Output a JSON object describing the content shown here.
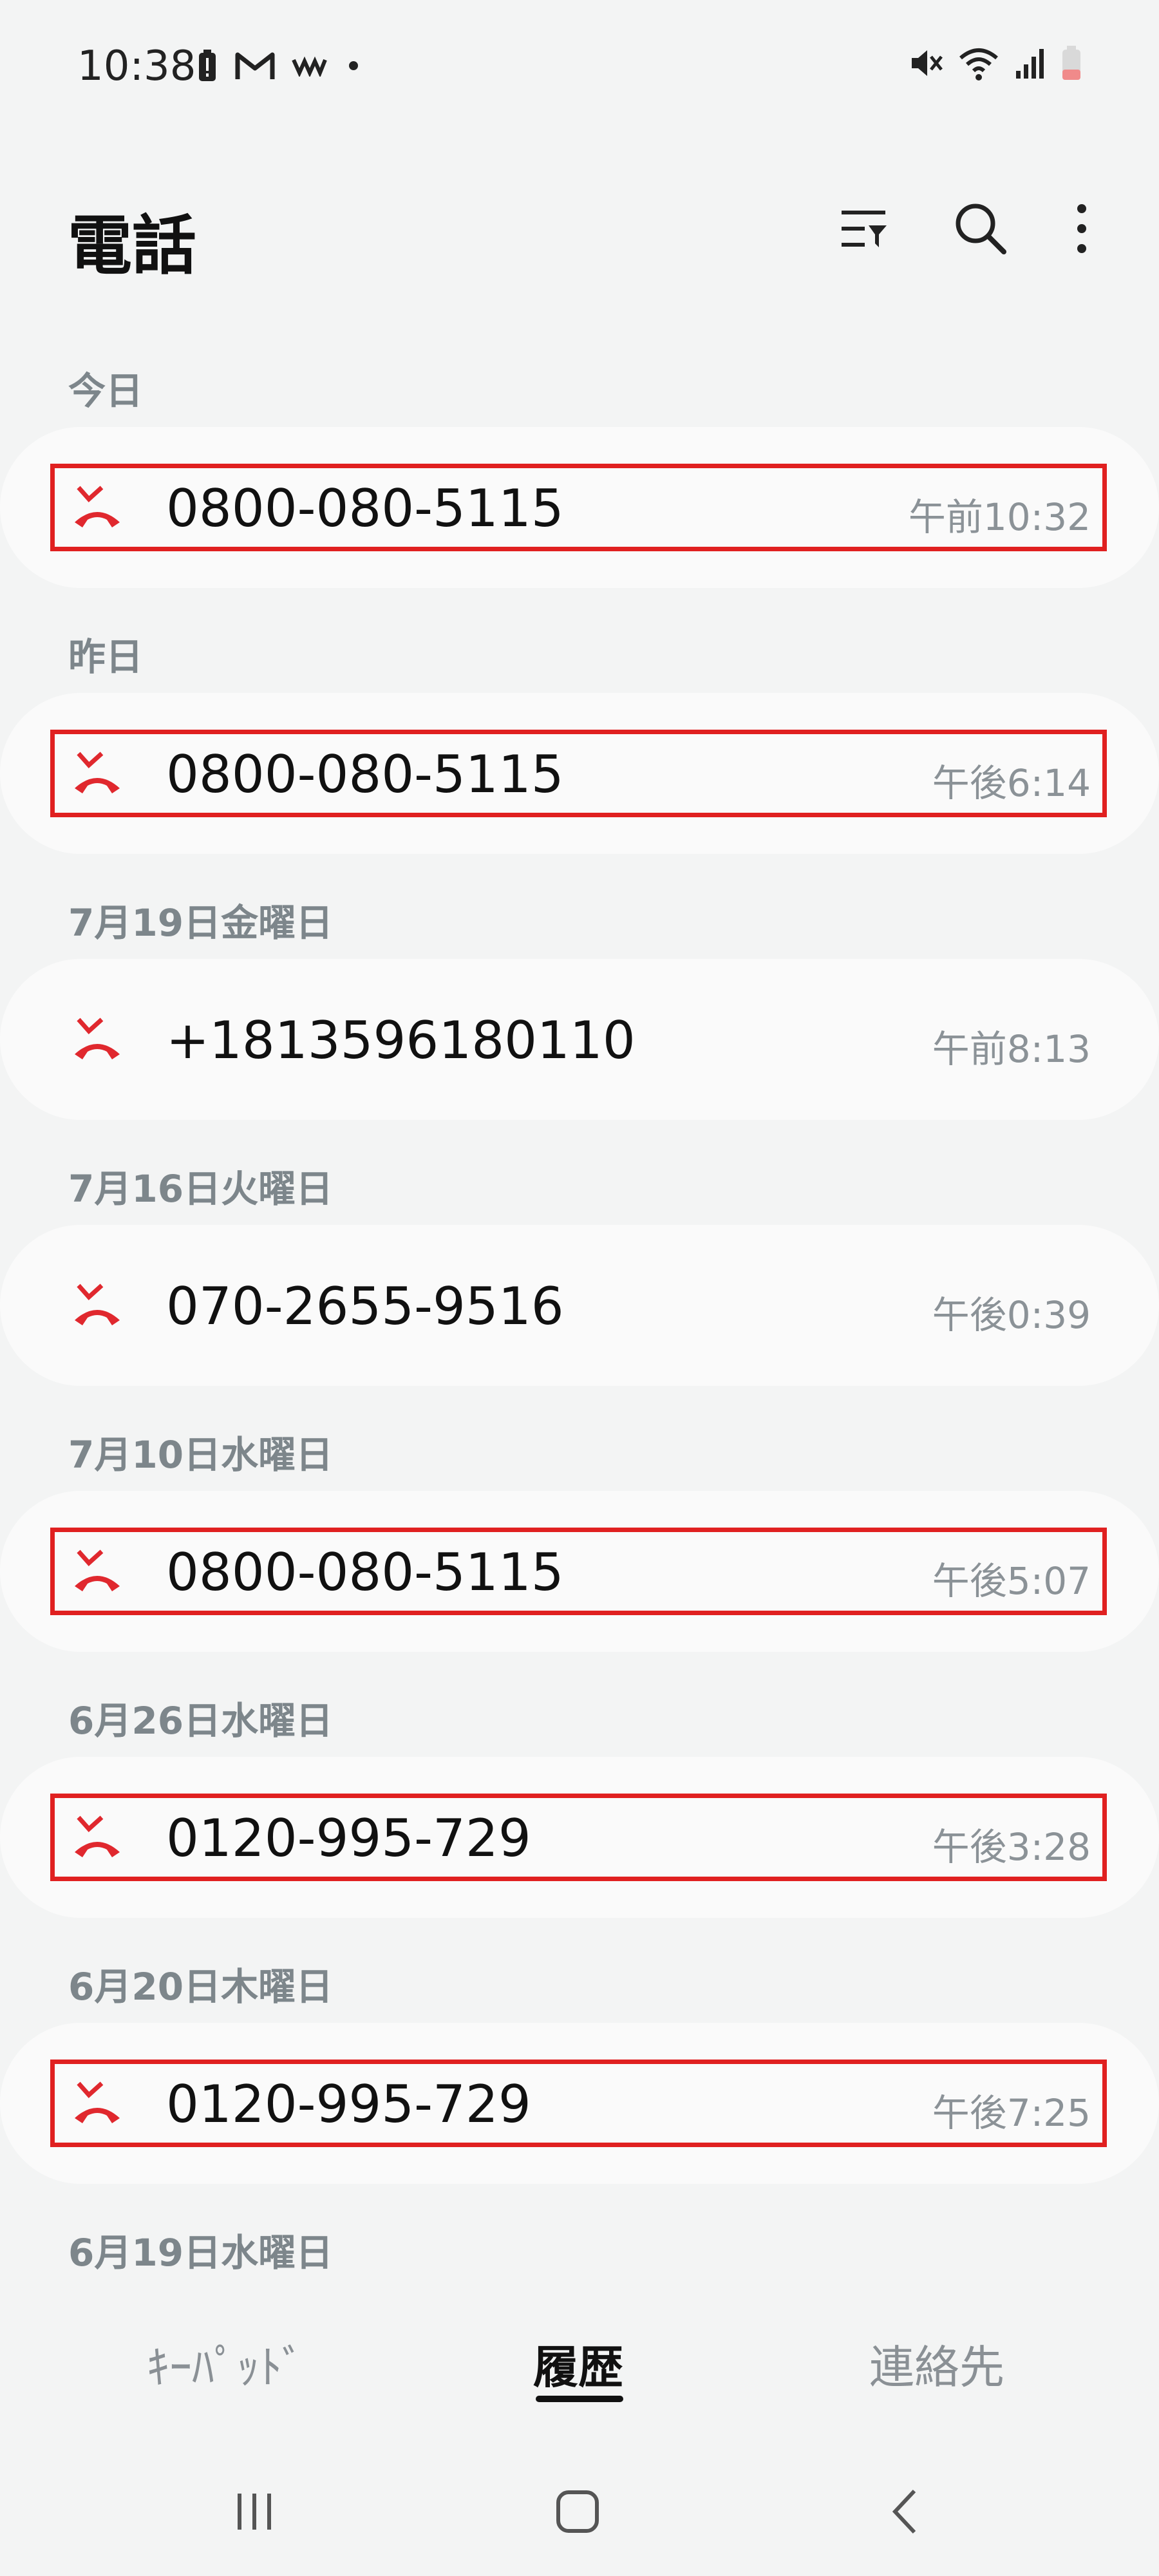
{
  "status_bar": {
    "time": "10:38",
    "left_icons": [
      "battery-alert-icon",
      "gmail-icon",
      "app-notification-icon",
      "dot-icon"
    ],
    "right_icons": [
      "mute-icon",
      "wifi-icon",
      "signal-icon",
      "battery-low-icon"
    ]
  },
  "header": {
    "title": "電話",
    "actions": [
      "filter-icon",
      "search-icon",
      "more-icon"
    ]
  },
  "calls": [
    {
      "date": "今日",
      "number": "0800-080-5115",
      "time": "午前10:32",
      "highlighted": true
    },
    {
      "date": "昨日",
      "number": "0800-080-5115",
      "time": "午後6:14",
      "highlighted": true
    },
    {
      "date": "7月19日金曜日",
      "number": "+1813596180110",
      "time": "午前8:13",
      "highlighted": false
    },
    {
      "date": "7月16日火曜日",
      "number": "070-2655-9516",
      "time": "午後0:39",
      "highlighted": false
    },
    {
      "date": "7月10日水曜日",
      "number": "0800-080-5115",
      "time": "午後5:07",
      "highlighted": true
    },
    {
      "date": "6月26日水曜日",
      "number": "0120-995-729",
      "time": "午後3:28",
      "highlighted": true
    },
    {
      "date": "6月20日木曜日",
      "number": "0120-995-729",
      "time": "午後7:25",
      "highlighted": true
    }
  ],
  "next_date_header": "6月19日水曜日",
  "tabs": {
    "keypad": "ｷｰﾊﾟｯﾄﾞ",
    "history": "履歴",
    "contacts": "連絡先",
    "active": "history"
  },
  "colors": {
    "missed_call": "#e0282e",
    "highlight_border": "#e02020",
    "background": "#f3f4f4",
    "card": "#fafafa",
    "date_text": "#7d868b"
  },
  "system_nav": [
    "recents-icon",
    "home-icon",
    "back-icon"
  ]
}
